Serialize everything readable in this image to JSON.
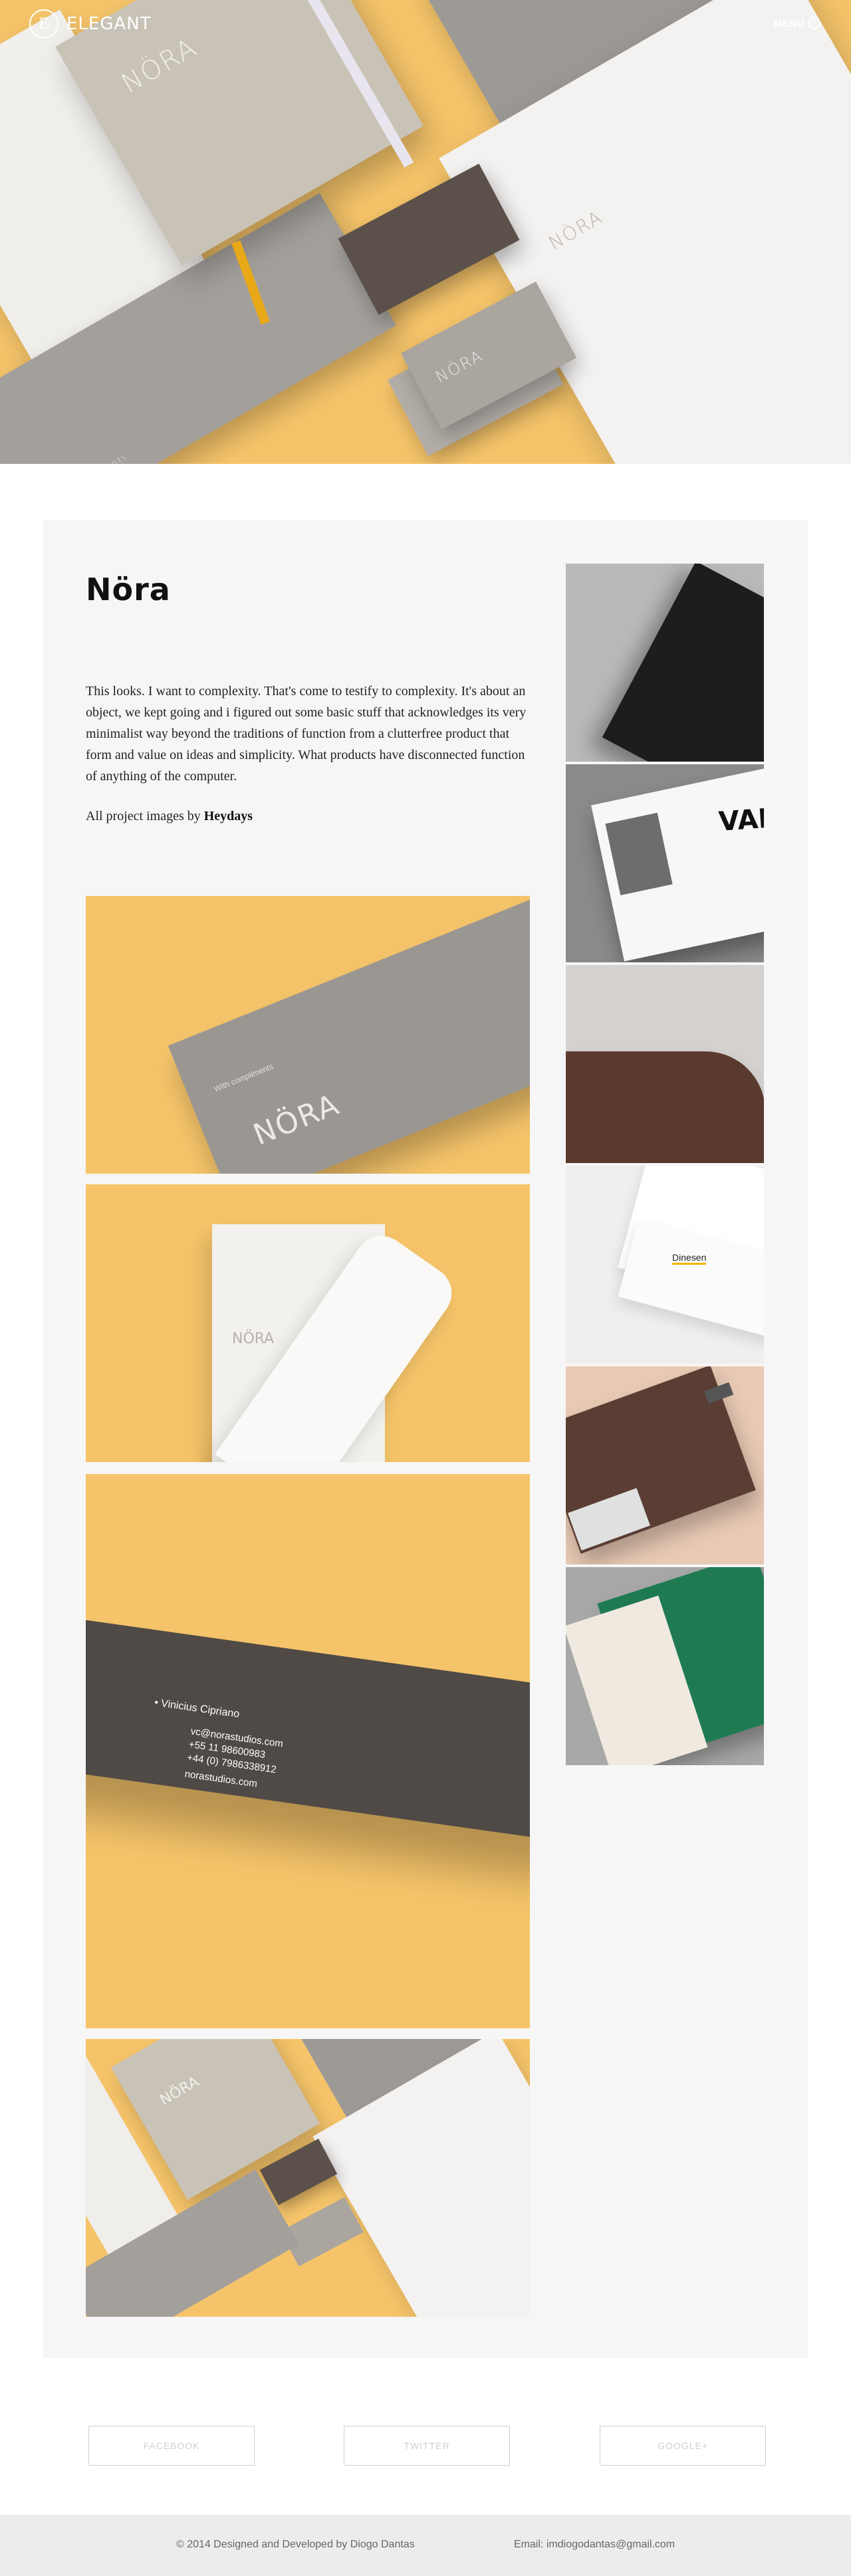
{
  "header": {
    "logo_letter": "E",
    "logo_text": "ELEGANT",
    "menu_label": "MENU"
  },
  "hero": {
    "notebook_text": "NÖRA",
    "letterhead_text": "NÖRA",
    "card_text": "NÖRA",
    "envelope_text": "With compliments"
  },
  "project": {
    "title": "Nöra",
    "description": "This looks. I want to complexity. That's come to testify to complexity. It's about an object, we kept going and i figured out some basic stuff that acknowledges its very minimalist way beyond the traditions of function from a clutterfree product that form and value on ideas and simplicity. What products have disconnected function of anything of the computer.",
    "credit_prefix": "All project images by",
    "credit_name": "Heydays",
    "photos": {
      "envelope_nora": "NÖRA",
      "envelope_caption": "With compliments",
      "letter_nora": "NÖRA",
      "card_name": "• Vinicius Cipriano",
      "card_email": "vc@norastudios.com",
      "card_phone1": "+55 11 98600983",
      "card_phone2": "+44 (0) 7986338912",
      "card_site": "norastudios.com",
      "composite_nora": "NÖRA"
    },
    "side_photos": {
      "valu_text": "VALU",
      "dinesen_text": "Dinesen"
    }
  },
  "social": {
    "facebook": "FACEBOOK",
    "twitter": "TWITTER",
    "googleplus": "GOOGLE+"
  },
  "footer": {
    "copyright": "© 2014 Designed and Developed by Diogo Dantas",
    "email": "Email: imdiogodantas@gmail.com"
  },
  "colors": {
    "hero_yellow": "#f5c46a",
    "card_bg": "#f7f6f6",
    "footer_bg": "#ececec"
  }
}
